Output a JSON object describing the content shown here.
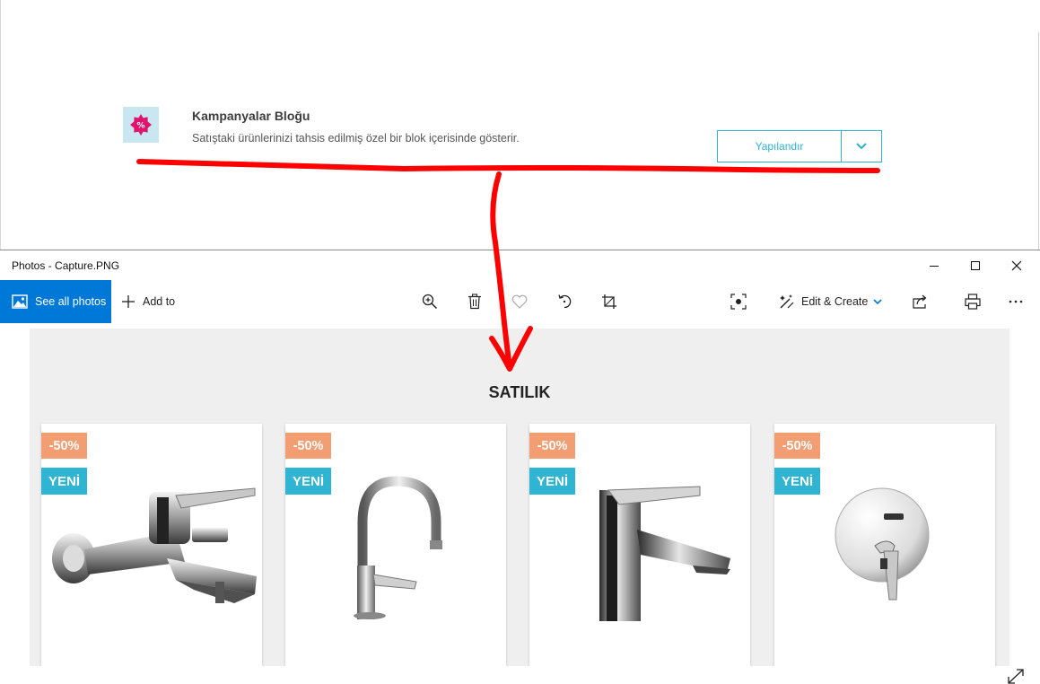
{
  "module": {
    "title": "Kampanyalar Bloğu",
    "description": "Satıştaki ürünlerinizi tahsis edilmiş özel bir blok içerisinde gösterir.",
    "configure_label": "Yapılandır"
  },
  "window": {
    "title": "Photos - Capture.PNG"
  },
  "toolbar": {
    "see_all_label": "See all photos",
    "add_to_label": "Add to",
    "edit_create_label": "Edit & Create"
  },
  "capture": {
    "heading": "SATILIK",
    "products": [
      {
        "discount": "-50%",
        "badge": "YENİ",
        "image": "bath-mixer-faucet"
      },
      {
        "discount": "-50%",
        "badge": "YENİ",
        "image": "gooseneck-faucet"
      },
      {
        "discount": "-50%",
        "badge": "YENİ",
        "image": "basin-mixer-faucet"
      },
      {
        "discount": "-50%",
        "badge": "YENİ",
        "image": "concealed-shower-mixer"
      }
    ]
  },
  "colors": {
    "accent": "#2fb5d2",
    "photos_blue": "#0078d7",
    "discount": "#f39d72",
    "annotation_red": "#ff0000"
  }
}
